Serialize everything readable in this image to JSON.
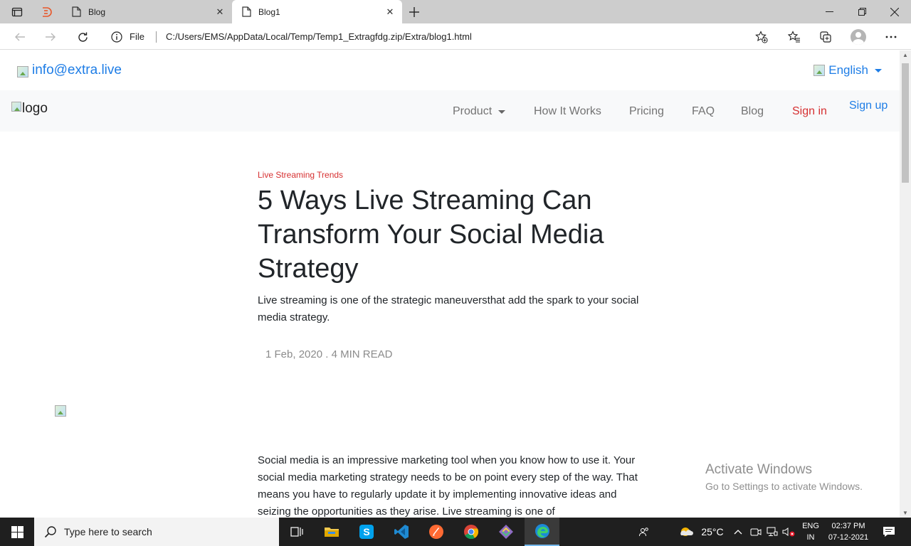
{
  "browser": {
    "tabs": [
      {
        "title": "Blog",
        "active": false
      },
      {
        "title": "Blog1",
        "active": true
      }
    ],
    "address": {
      "scheme_label": "File",
      "url": "C:/Users/EMS/AppData/Local/Temp/Temp1_Extragfdg.zip/Extra/blog1.html"
    }
  },
  "page": {
    "topbar": {
      "email": "info@extra.live",
      "language": "English"
    },
    "navbar": {
      "logo_alt": "logo",
      "items": [
        {
          "label": "Product",
          "dropdown": true
        },
        {
          "label": "How It Works"
        },
        {
          "label": "Pricing"
        },
        {
          "label": "FAQ"
        },
        {
          "label": "Blog"
        }
      ],
      "sign_in": "Sign in",
      "sign_up": "Sign up"
    },
    "article": {
      "category": "Live Streaming Trends",
      "title": "5 Ways Live Streaming Can Transform Your Social Media Strategy",
      "lead": "Live streaming is one of the strategic maneuversthat add the spark to your social media strategy.",
      "meta": "1 Feb, 2020 . 4 MIN READ",
      "body": "Social media is an impressive marketing tool when you know how to use it. Your social media marketing strategy needs to be on point every step of the way. That means you have to regularly update it by implementing innovative ideas and seizing the opportunities as they arise. Live streaming is one of"
    },
    "watermark": {
      "line1": "Activate Windows",
      "line2": "Go to Settings to activate Windows."
    }
  },
  "taskbar": {
    "search_placeholder": "Type here to search",
    "weather": "25°C",
    "language": "ENG",
    "region": "IN",
    "time": "02:37 PM",
    "date": "07-12-2021"
  },
  "colors": {
    "accent": "#1e7de6",
    "danger": "#d63031",
    "navbar_bg": "#f8f9fa"
  }
}
